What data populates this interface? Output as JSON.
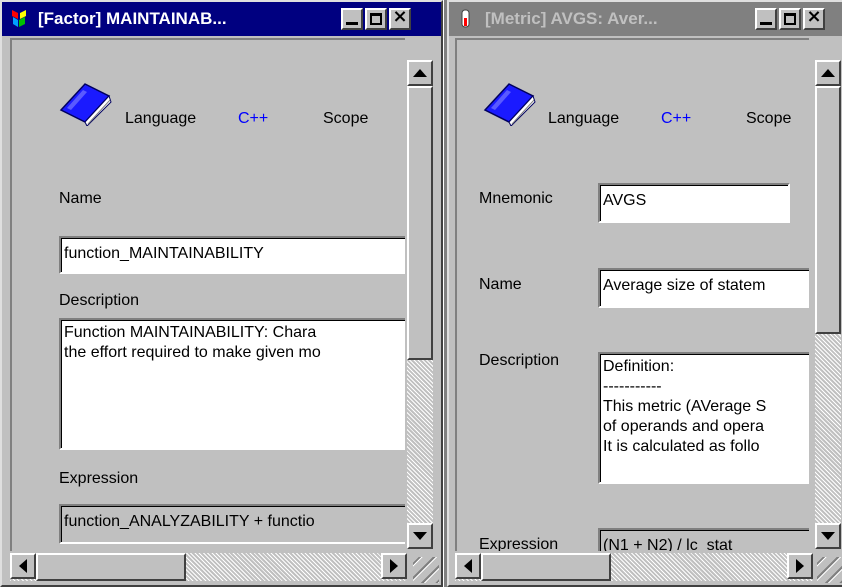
{
  "windows": [
    {
      "title": "[Factor] MAINTAINAB...",
      "title_icon": "factor-cubes-icon",
      "active": true,
      "language_label": "Language",
      "language_value": "C++",
      "scope_label": "Scope",
      "name_label": "Name",
      "name_value": "function_MAINTAINABILITY",
      "description_label": "Description",
      "description_value": "Function MAINTAINABILITY: Chara\nthe effort required to make given mo",
      "expression_label": "Expression",
      "expression_value": "function_ANALYZABILITY + functio"
    },
    {
      "title": "[Metric] AVGS: Aver...",
      "title_icon": "metric-gauge-icon",
      "active": false,
      "language_label": "Language",
      "language_value": "C++",
      "scope_label": "Scope",
      "mnemonic_label": "Mnemonic",
      "mnemonic_value": "AVGS",
      "name_label": "Name",
      "name_value": "Average size of statem",
      "description_label": "Description",
      "description_value": "Definition:\n-----------\nThis metric (AVerage S\nof operands and opera\nIt is calculated as follo",
      "expression_label": "Expression",
      "expression_value": "(N1 + N2) / lc_stat"
    }
  ],
  "window_controls": {
    "minimize": "minimize-icon",
    "maximize": "maximize-icon",
    "close": "close-icon"
  },
  "colors": {
    "active_title": "#000080",
    "inactive_title": "#808080",
    "language_value": "#0000ff",
    "face": "#c0c0c0"
  }
}
